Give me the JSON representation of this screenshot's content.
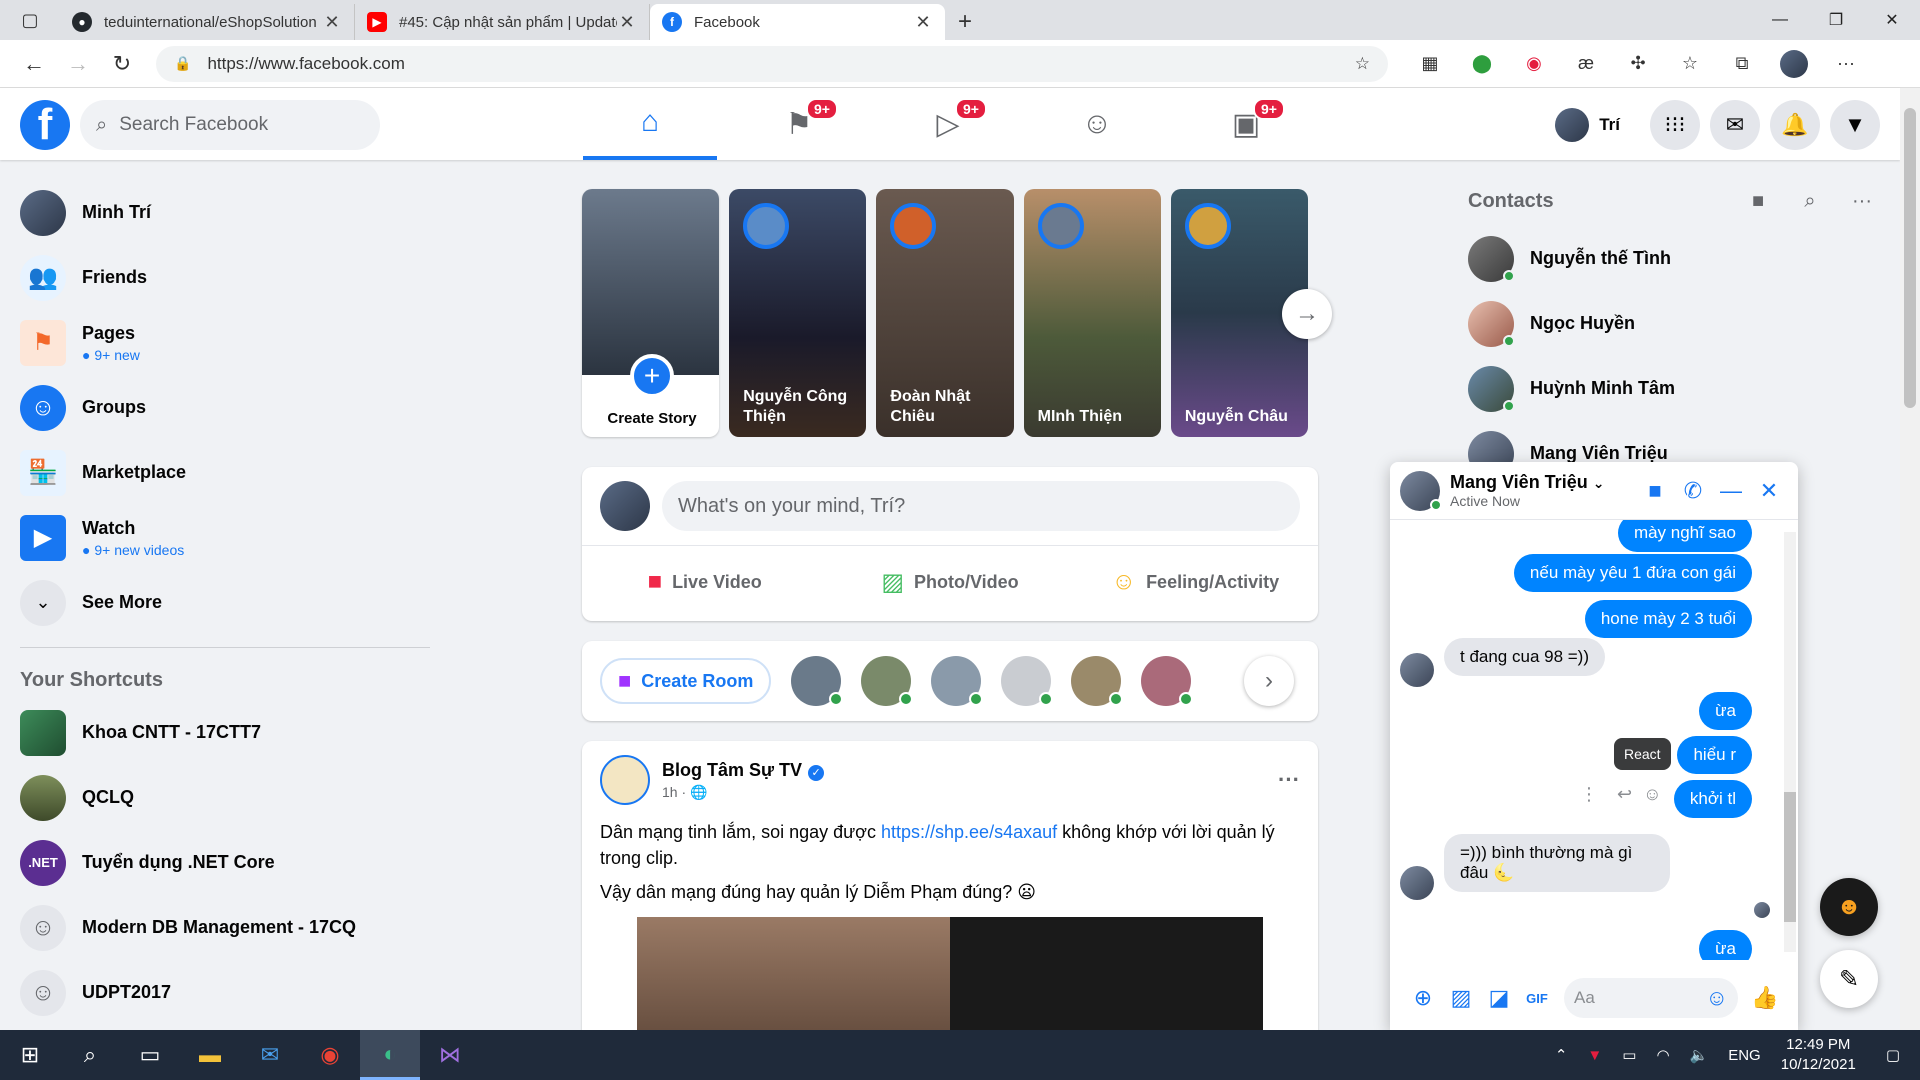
{
  "browser": {
    "tabs": [
      {
        "title": "teduinternational/eShopSolution",
        "icon": "github-icon",
        "color": "#24292e"
      },
      {
        "title": "#45: Cập nhật sản phẩm | Update",
        "icon": "youtube-icon",
        "color": "#ff0000"
      },
      {
        "title": "Facebook",
        "icon": "facebook-icon",
        "color": "#1877f2",
        "active": true
      }
    ],
    "url": "https://www.facebook.com"
  },
  "header": {
    "search_placeholder": "Search Facebook",
    "badges": {
      "pages": "9+",
      "watch": "9+",
      "gaming": "9+"
    },
    "user_name": "Trí"
  },
  "leftnav": {
    "profile": "Minh Trí",
    "items": [
      {
        "label": "Friends"
      },
      {
        "label": "Pages",
        "sub": "9+ new"
      },
      {
        "label": "Groups"
      },
      {
        "label": "Marketplace"
      },
      {
        "label": "Watch",
        "sub": "9+ new videos"
      },
      {
        "label": "See More"
      }
    ],
    "shortcuts_title": "Your Shortcuts",
    "shortcuts": [
      "Khoa CNTT - 17CTT7",
      "QCLQ",
      "Tuyển dụng .NET Core",
      "Modern DB Management - 17CQ",
      "UDPT2017"
    ]
  },
  "stories": {
    "create_label": "Create Story",
    "items": [
      {
        "name_line1": "Nguyễn Công",
        "name_line2": "Thiện"
      },
      {
        "name_line1": "Đoàn Nhật",
        "name_line2": "Chiêu"
      },
      {
        "name_line1": "MInh Thiện",
        "name_line2": ""
      },
      {
        "name_line1": "Nguyễn Châu",
        "name_line2": ""
      }
    ]
  },
  "composer": {
    "placeholder": "What's on your mind, Trí?",
    "live": "Live Video",
    "photo": "Photo/Video",
    "feeling": "Feeling/Activity"
  },
  "rooms": {
    "create_label": "Create Room"
  },
  "post": {
    "author": "Blog Tâm Sự TV",
    "time": "1h ·",
    "text_before_link": "Dân mạng tinh lắm, soi ngay được ",
    "link": "https://shp.ee/s4axauf",
    "text_after_link": " không khớp với lời quản lý trong clip.",
    "text2": "Vậy dân mạng đúng hay quản lý Diễm Phạm đúng? 😦"
  },
  "contacts": {
    "title": "Contacts",
    "items": [
      "Nguyễn thế Tình",
      "Ngọc Huyền",
      "Huỳnh Minh Tâm",
      "Mang Viên Triệu"
    ]
  },
  "chat": {
    "name": "Mang Viên Triệu",
    "status": "Active Now",
    "messages": {
      "m1": "mày nghĩ sao",
      "m2": "nếu mày yêu 1 đứa con gái",
      "m3": "hone mày 2 3 tuổi",
      "m4": "t đang cua 98 =))",
      "m5": "ừa",
      "m6": "hiểu r",
      "m7": "khởi tl",
      "m8": "=))) bình thường mà gì đâu 🌜",
      "m9": "ừa"
    },
    "tooltip": "React",
    "input_placeholder": "Aa"
  },
  "taskbar": {
    "lang": "ENG",
    "time": "12:49 PM",
    "date": "10/12/2021"
  }
}
